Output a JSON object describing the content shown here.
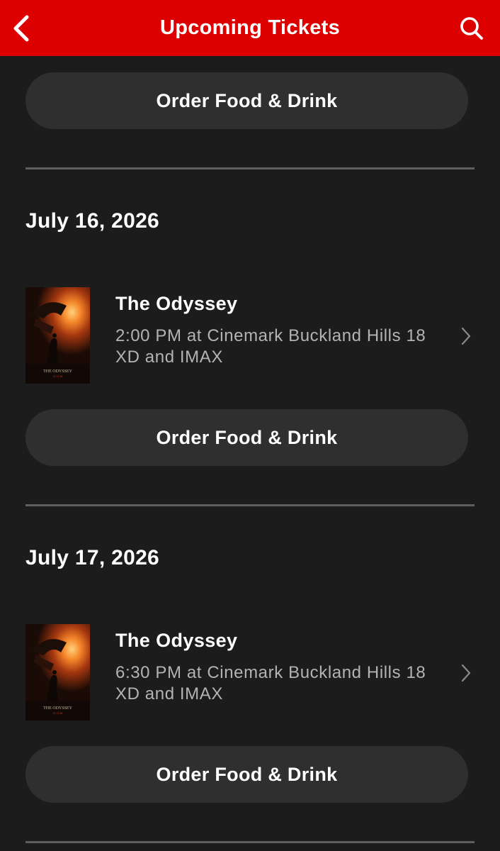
{
  "header": {
    "title": "Upcoming Tickets",
    "back_icon": "chevron-left-icon",
    "search_icon": "search-icon",
    "background_color": "#dc0000"
  },
  "top_order_button": {
    "label": "Order Food & Drink"
  },
  "sections": [
    {
      "date": "July 16, 2026",
      "ticket": {
        "title": "The Odyssey",
        "showtime": "2:00 PM at Cinemark Buckland Hills 18 XD and IMAX",
        "poster_caption": "THE ODYSSEY",
        "poster_sub": "07.17.26"
      },
      "order_label": "Order Food & Drink"
    },
    {
      "date": "July 17, 2026",
      "ticket": {
        "title": "The Odyssey",
        "showtime": "6:30 PM at Cinemark Buckland Hills 18 XD and IMAX",
        "poster_caption": "THE ODYSSEY",
        "poster_sub": "07.17.26"
      },
      "order_label": "Order Food & Drink"
    }
  ]
}
